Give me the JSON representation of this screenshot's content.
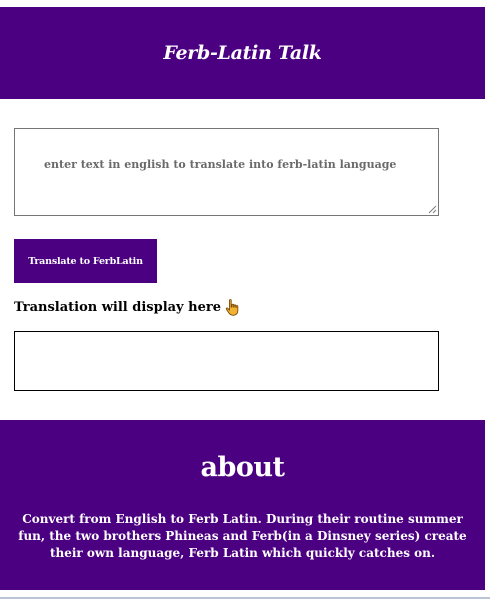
{
  "header": {
    "title": "Ferb-Latin Talk"
  },
  "input": {
    "placeholder": "enter text in english to translate into ferb-latin language",
    "value": ""
  },
  "translate_button": {
    "label": "Translate to FerbLatin"
  },
  "result": {
    "label": "Translation will display here",
    "icon": "pointing-down-hand-icon",
    "output": ""
  },
  "about": {
    "title": "about",
    "text": "Convert from English to Ferb Latin. During their routine summer fun, the two brothers Phineas and Ferb(in a Dinsney series) create their own language, Ferb Latin which quickly catches on."
  },
  "colors": {
    "brand_purple": "#4b0082",
    "text_on_brand": "#ffffff"
  }
}
